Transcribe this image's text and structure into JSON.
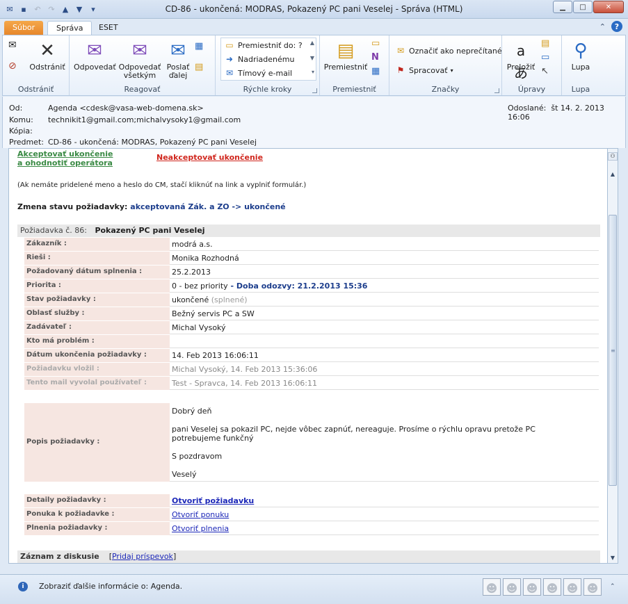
{
  "window": {
    "title": "CD-86 - ukončená: MODRAS, Pokazený PC pani Veselej  -  Správa (HTML)"
  },
  "tabs": {
    "file": "Súbor",
    "active": "Správa",
    "eset": "ESET"
  },
  "ribbon": {
    "delete_group": "Odstrániť",
    "delete_btn": "Odstrániť",
    "respond_group": "Reagovať",
    "reply": "Odpovedať",
    "reply_all_1": "Odpovedať",
    "reply_all_2": "všetkým",
    "forward_1": "Poslať",
    "forward_2": "ďalej",
    "quick_group": "Rýchle kroky",
    "qs1": "Premiestniť do: ?",
    "qs2": "Nadriadenému",
    "qs3": "Tímový e-mail",
    "move_group": "Premiestniť",
    "move_btn": "Premiestniť",
    "tags_group": "Značky",
    "mark_unread": "Označiť ako neprečítané",
    "followup": "Spracovať",
    "edit_group": "Úpravy",
    "translate": "Preložiť",
    "zoom_group": "Lupa",
    "zoom_btn": "Lupa"
  },
  "header": {
    "from_label": "Od:",
    "from": "Agenda <cdesk@vasa-web-domena.sk>",
    "to_label": "Komu:",
    "to": "technikit1@gmail.com;michalvysoky1@gmail.com",
    "cc_label": "Kópia:",
    "subject_label": "Predmet:",
    "subject": "CD-86 - ukončená: MODRAS, Pokazený PC pani Veselej",
    "sent_label": "Odoslané:",
    "sent": "št 14. 2. 2013 16:06"
  },
  "body": {
    "accept_link_1": "Akceptovať ukončenie",
    "accept_link_2": "a ohodnotiť operátora",
    "reject_link": "Neakceptovať ukončenie",
    "note": "(Ak nemáte pridelené meno a heslo do CM, stačí kliknúť na link a vyplniť formulár.)",
    "change_label": "Zmena stavu požiadavky:",
    "change_value": "akceptovaná Zák. a ZO -> ukončené",
    "request_num": "Požiadavka č. 86:",
    "request_title": "Pokazený PC pani Veselej",
    "rows": [
      {
        "label": "Zákazník :",
        "value": "modrá a.s."
      },
      {
        "label": "Rieši :",
        "value": "Monika Rozhodná"
      },
      {
        "label": "Požadovaný dátum splnenia :",
        "value": "25.2.2013"
      },
      {
        "label": "Priorita :",
        "value": "0 - bez priority",
        "extra": " - Doba odozvy: 21.2.2013 15:36"
      },
      {
        "label": "Stav požiadavky :",
        "value": "ukončené",
        "extra": " (splnené)"
      },
      {
        "label": "Oblasť služby :",
        "value": "Bežný servis PC a SW"
      },
      {
        "label": "Zadávateľ :",
        "value": "Michal Vysoký"
      },
      {
        "label": "Kto má problém :",
        "value": ""
      },
      {
        "label": "Dátum ukončenia požiadavky :",
        "value": "14. Feb 2013 16:06:11"
      },
      {
        "label": "Požiadavku vložil :",
        "value": "Michal Vysoký, 14. Feb 2013 15:36:06"
      },
      {
        "label": "Tento mail vyvolal používateľ :",
        "value": "Test - Spravca, 14. Feb 2013 16:06:11"
      }
    ],
    "desc_label": "Popis požiadavky :",
    "desc_1": "Dobrý deň",
    "desc_2": "pani Veselej sa pokazil PC, nejde vôbec zapnúť, nereaguje. Prosíme o rýchlu opravu pretože PC potrebujeme funkčný",
    "desc_3": "S pozdravom",
    "desc_4": "Veselý",
    "links": [
      {
        "label": "Detaily požiadavky :",
        "value": "Otvoriť požiadavku"
      },
      {
        "label": "Ponuka k požiadavke :",
        "value": "Otvoriť ponuku"
      },
      {
        "label": "Plnenia požiadavky :",
        "value": "Otvoriť plnenia"
      }
    ],
    "discussion": "Záznam z diskusie",
    "add_post": "Pridaj príspevok"
  },
  "status": {
    "text": "Zobraziť ďalšie informácie o: Agenda."
  }
}
